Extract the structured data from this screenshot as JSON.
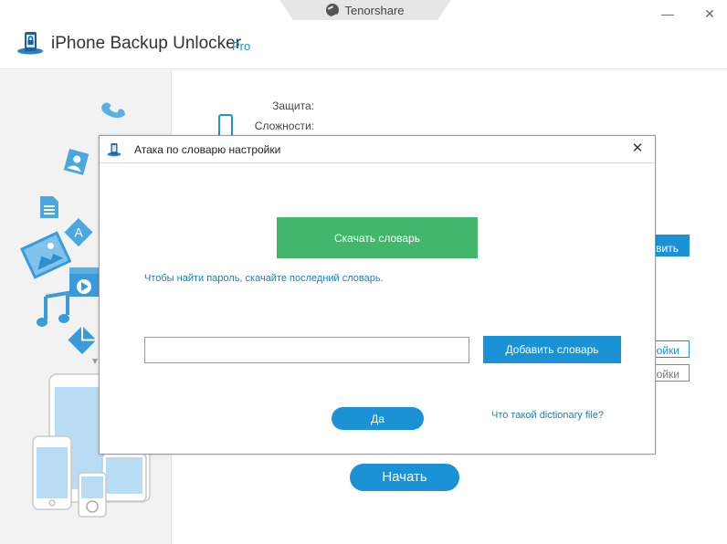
{
  "window": {
    "brand": "Tenorshare",
    "app_title": "iPhone Backup Unlocker",
    "edition": "Pro",
    "minimize_glyph": "—",
    "close_glyph": "✕"
  },
  "main": {
    "protection_label": "Защита:",
    "complexity_label": "Сложности:",
    "partial_button_1": "вить",
    "partial_button_2": "ойки",
    "partial_button_3": "ойки",
    "start_button": "Начать"
  },
  "dialog": {
    "title": "Атака по словарю настройки",
    "close_glyph": "✕",
    "download_button": "Скачать словарь",
    "hint_text": "Чтобы найти пароль, скачайте последний словарь.",
    "dictionary_path_value": "",
    "add_button": "Добавить словарь",
    "ok_button": "Да",
    "help_link": "Что такой dictionary file?"
  },
  "colors": {
    "accent_blue": "#1b92d6",
    "download_green": "#42b76b",
    "link_blue": "#1b7fc1",
    "sidebar_bg": "#f2f2f2",
    "icon_light_blue": "#4aa8de"
  },
  "icons": [
    "tenorshare-logo-icon",
    "app-lock-icon",
    "dialog-app-icon",
    "close-icon",
    "minimize-icon",
    "phone-icon",
    "contact-icon",
    "document-icon",
    "app-store-icon",
    "photo-icon",
    "video-icon",
    "music-note-icon",
    "mail-icon",
    "tablet-icon",
    "iphone-icon",
    "ipod-icon"
  ]
}
